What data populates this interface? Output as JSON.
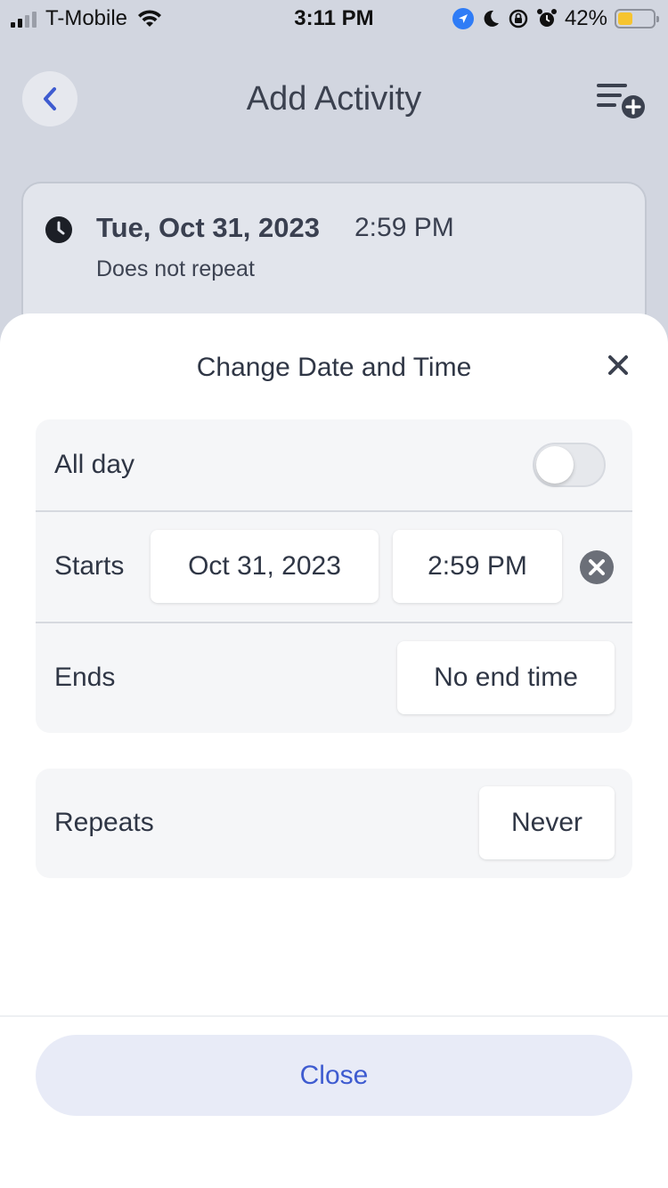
{
  "status_bar": {
    "carrier": "T-Mobile",
    "time": "3:11 PM",
    "battery_percent": "42%",
    "battery_level": 0.42,
    "icons": [
      "signal-icon",
      "wifi-icon",
      "location-icon",
      "moon-icon",
      "rotation-lock-icon",
      "alarm-icon",
      "battery-icon"
    ]
  },
  "header": {
    "title": "Add Activity",
    "back_icon": "chevron-left-icon",
    "action_icon": "add-to-list-icon"
  },
  "activity_card": {
    "date": "Tue, Oct 31, 2023",
    "time": "2:59 PM",
    "repeat": "Does not repeat",
    "icon": "clock-icon"
  },
  "sheet": {
    "title": "Change Date and Time",
    "close_icon": "close-icon",
    "all_day": {
      "label": "All day",
      "enabled": false
    },
    "starts": {
      "label": "Starts",
      "date": "Oct 31, 2023",
      "time": "2:59 PM",
      "clear_icon": "clear-circle-icon"
    },
    "ends": {
      "label": "Ends",
      "value": "No end time"
    },
    "repeats": {
      "label": "Repeats",
      "value": "Never"
    },
    "close_button": "Close"
  },
  "colors": {
    "accent": "#3e5bd0",
    "dim_background": "#d2d6e0",
    "group_background": "#f5f6f8",
    "close_button_bg": "#e8ebf7",
    "battery_fill": "#f6c430"
  }
}
